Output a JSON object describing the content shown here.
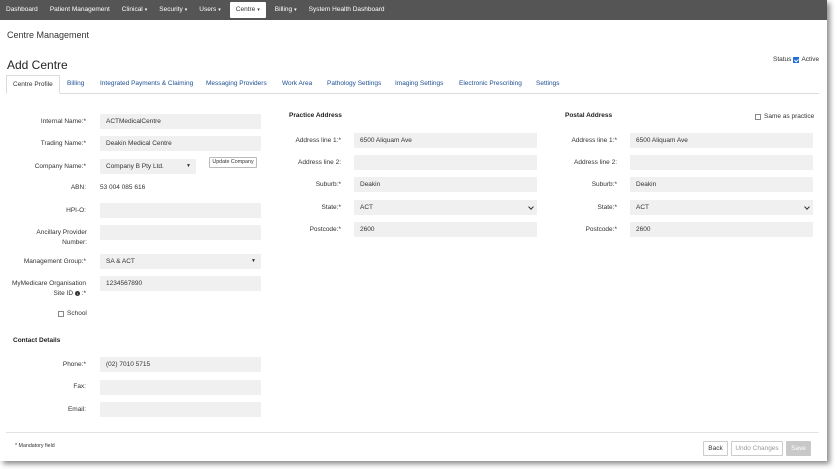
{
  "nav": {
    "items": [
      {
        "label": "Dashboard"
      },
      {
        "label": "Patient Management"
      },
      {
        "label": "Clinical",
        "caret": "▾"
      },
      {
        "label": "Security",
        "caret": "▾"
      },
      {
        "label": "Users",
        "caret": "▾"
      },
      {
        "label": "Centre",
        "caret": "▾"
      },
      {
        "label": "Billing",
        "caret": "▾"
      },
      {
        "label": "System Health Dashboard"
      }
    ]
  },
  "breadcrumb": "Centre Management",
  "page_title": "Add Centre",
  "status": {
    "label": "Status",
    "value": "Active",
    "checked": true
  },
  "tabs": [
    "Centre Profile",
    "Billing",
    "Integrated Payments & Claiming",
    "Messaging Providers",
    "Work Area",
    "Pathology Settings",
    "Imaging Settings",
    "Electronic Prescribing",
    "Settings"
  ],
  "profile": {
    "internal_name_label": "Internal Name:*",
    "internal_name_value": "ACTMedicalCentre",
    "trading_name_label": "Trading Name:*",
    "trading_name_value": "Deakin Medical Centre",
    "company_name_label": "Company Name:*",
    "company_name_value": "Company B Pty Ltd.",
    "update_company_label": "Update Company",
    "abn_label": "ABN:",
    "abn_value": "53 004 085 616",
    "hpio_label": "HPI-O:",
    "hpio_value": "",
    "ancillary_label": "Ancillary Provider Number:",
    "ancillary_value": "",
    "management_group_label": "Management Group:*",
    "management_group_value": "SA & ACT",
    "mymedicare_label_1": "MyMedicare Organisation",
    "mymedicare_label_2": "Site ID",
    "mymedicare_info": "i",
    "mymedicare_required": ":*",
    "mymedicare_value": "1234567890",
    "school_label": "School"
  },
  "contact": {
    "title": "Contact Details",
    "phone_label": "Phone:*",
    "phone_value": "(02) 7010 5715",
    "fax_label": "Fax:",
    "fax_value": "",
    "email_label": "Email:",
    "email_value": ""
  },
  "practice_address": {
    "title": "Practice Address",
    "line1_label": "Address line 1:*",
    "line1_value": "6500 Aliquam Ave",
    "line2_label": "Address line 2:",
    "line2_value": "",
    "suburb_label": "Suburb:*",
    "suburb_value": "Deakin",
    "state_label": "State:*",
    "state_value": "ACT",
    "postcode_label": "Postcode:*",
    "postcode_value": "2600"
  },
  "postal_address": {
    "title": "Postal Address",
    "same_as_practice_label": "Same as practice",
    "line1_label": "Address line 1:*",
    "line1_value": "6500 Aliquam Ave",
    "line2_label": "Address line 2:",
    "line2_value": "",
    "suburb_label": "Suburb:*",
    "suburb_value": "Deakin",
    "state_label": "State:*",
    "state_value": "ACT",
    "postcode_label": "Postcode:*",
    "postcode_value": "2600"
  },
  "footer": {
    "mandatory_note": "* Mandatory field",
    "back_label": "Back",
    "undo_label": "Undo Changes",
    "save_label": "Save"
  },
  "colors": {
    "nav_bg": "#555555",
    "tab_link": "#1d4f91",
    "checkbox": "#1e6fd9",
    "field_bg": "#f0f0f0"
  }
}
